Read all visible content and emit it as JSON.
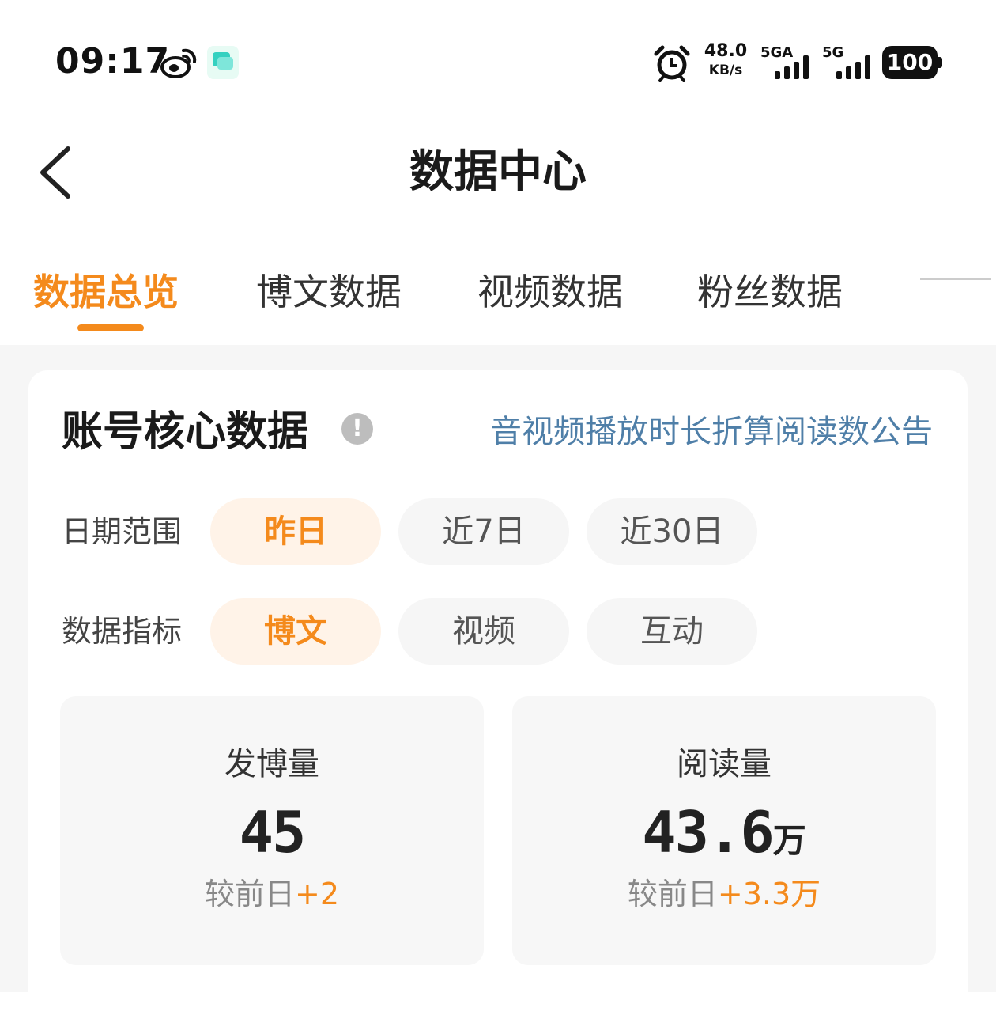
{
  "status_bar": {
    "time": "09:17",
    "net_speed_value": "48.0",
    "net_speed_unit": "KB/s",
    "signal1_label": "5GA",
    "signal2_label": "5G",
    "battery": "100",
    "icons": [
      "weibo-icon",
      "app-chat-icon",
      "alarm-icon",
      "signal-icon",
      "signal-icon",
      "battery-icon"
    ]
  },
  "header": {
    "title": "数据中心",
    "back_icon": "chevron-left-icon"
  },
  "tabs": [
    {
      "label": "数据总览",
      "active": true
    },
    {
      "label": "博文数据",
      "active": false
    },
    {
      "label": "视频数据",
      "active": false
    },
    {
      "label": "粉丝数据",
      "active": false
    }
  ],
  "accent_color": "#f48a1c",
  "link_color": "#4f7fa8",
  "card": {
    "title": "账号核心数据",
    "info_icon": "info-icon",
    "info_glyph": "!",
    "notice_link": "音视频播放时长折算阅读数公告",
    "date_range": {
      "label": "日期范围",
      "options": [
        "昨日",
        "近7日",
        "近30日"
      ],
      "selected": "昨日"
    },
    "metric": {
      "label": "数据指标",
      "options": [
        "博文",
        "视频",
        "互动"
      ],
      "selected": "博文"
    },
    "stats": [
      {
        "name": "发博量",
        "value": "45",
        "unit": "",
        "compare_prefix": "较前日",
        "compare_delta": "+2"
      },
      {
        "name": "阅读量",
        "value": "43.6",
        "unit": "万",
        "compare_prefix": "较前日",
        "compare_delta": "+3.3万"
      }
    ]
  }
}
